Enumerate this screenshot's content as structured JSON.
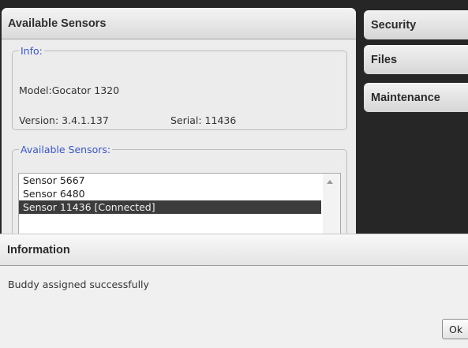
{
  "main_panel": {
    "title": "Available Sensors"
  },
  "info_group": {
    "legend": "Info:",
    "model": "Model:Gocator 1320",
    "version": "Version: 3.4.1.137",
    "serial": "Serial: 11436"
  },
  "sensors_group": {
    "legend": "Available Sensors:",
    "items": [
      {
        "label": "Sensor 5667",
        "selected": false
      },
      {
        "label": "Sensor 6480",
        "selected": false
      },
      {
        "label": "Sensor 11436 [Connected]",
        "selected": true
      }
    ]
  },
  "tabs": [
    {
      "label": "Security"
    },
    {
      "label": "Files"
    },
    {
      "label": "Maintenance"
    }
  ],
  "dialog": {
    "title": "Information",
    "message": "Buddy assigned successfully",
    "ok_label": "Ok"
  },
  "colors": {
    "background_dark": "#262626",
    "legend_blue": "#3b57c8",
    "selection": "#3c3c3c"
  }
}
